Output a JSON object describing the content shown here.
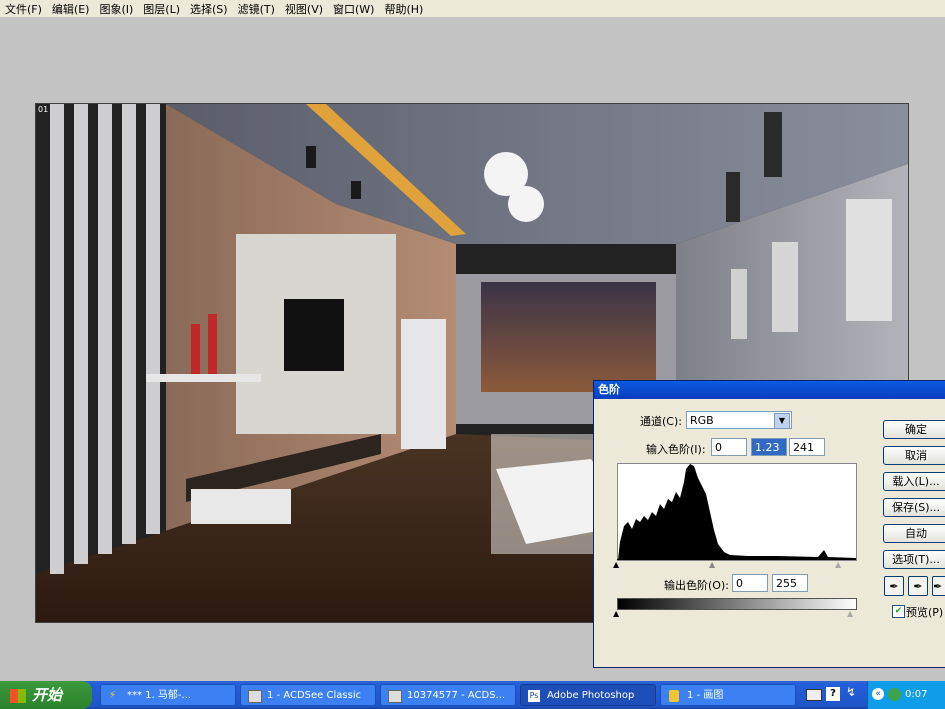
{
  "menu": [
    "文件(F)",
    "编辑(E)",
    "图象(I)",
    "图层(L)",
    "选择(S)",
    "滤镜(T)",
    "视图(V)",
    "窗口(W)",
    "帮助(H)"
  ],
  "document": {
    "label": "01"
  },
  "levels_dialog": {
    "title": "色阶",
    "channel_label": "通道(C):",
    "channel_value": "RGB",
    "input_label": "输入色阶(I):",
    "input_values": [
      "0",
      "1.23",
      "241"
    ],
    "output_label": "输出色阶(O):",
    "output_values": [
      "0",
      "255"
    ],
    "buttons": [
      "确定",
      "取消",
      "载入(L)...",
      "保存(S)...",
      "自动",
      "选项(T)..."
    ],
    "preview_label": "预览(P)",
    "preview_checked": true
  },
  "taskbar": {
    "start_label": "开始",
    "tasks": [
      "*** 1. 马郁-...",
      "1 - ACDSee Classic",
      "10374577 - ACDS...",
      "Adobe Photoshop",
      "1 - 画图"
    ],
    "clock": "0:07"
  }
}
